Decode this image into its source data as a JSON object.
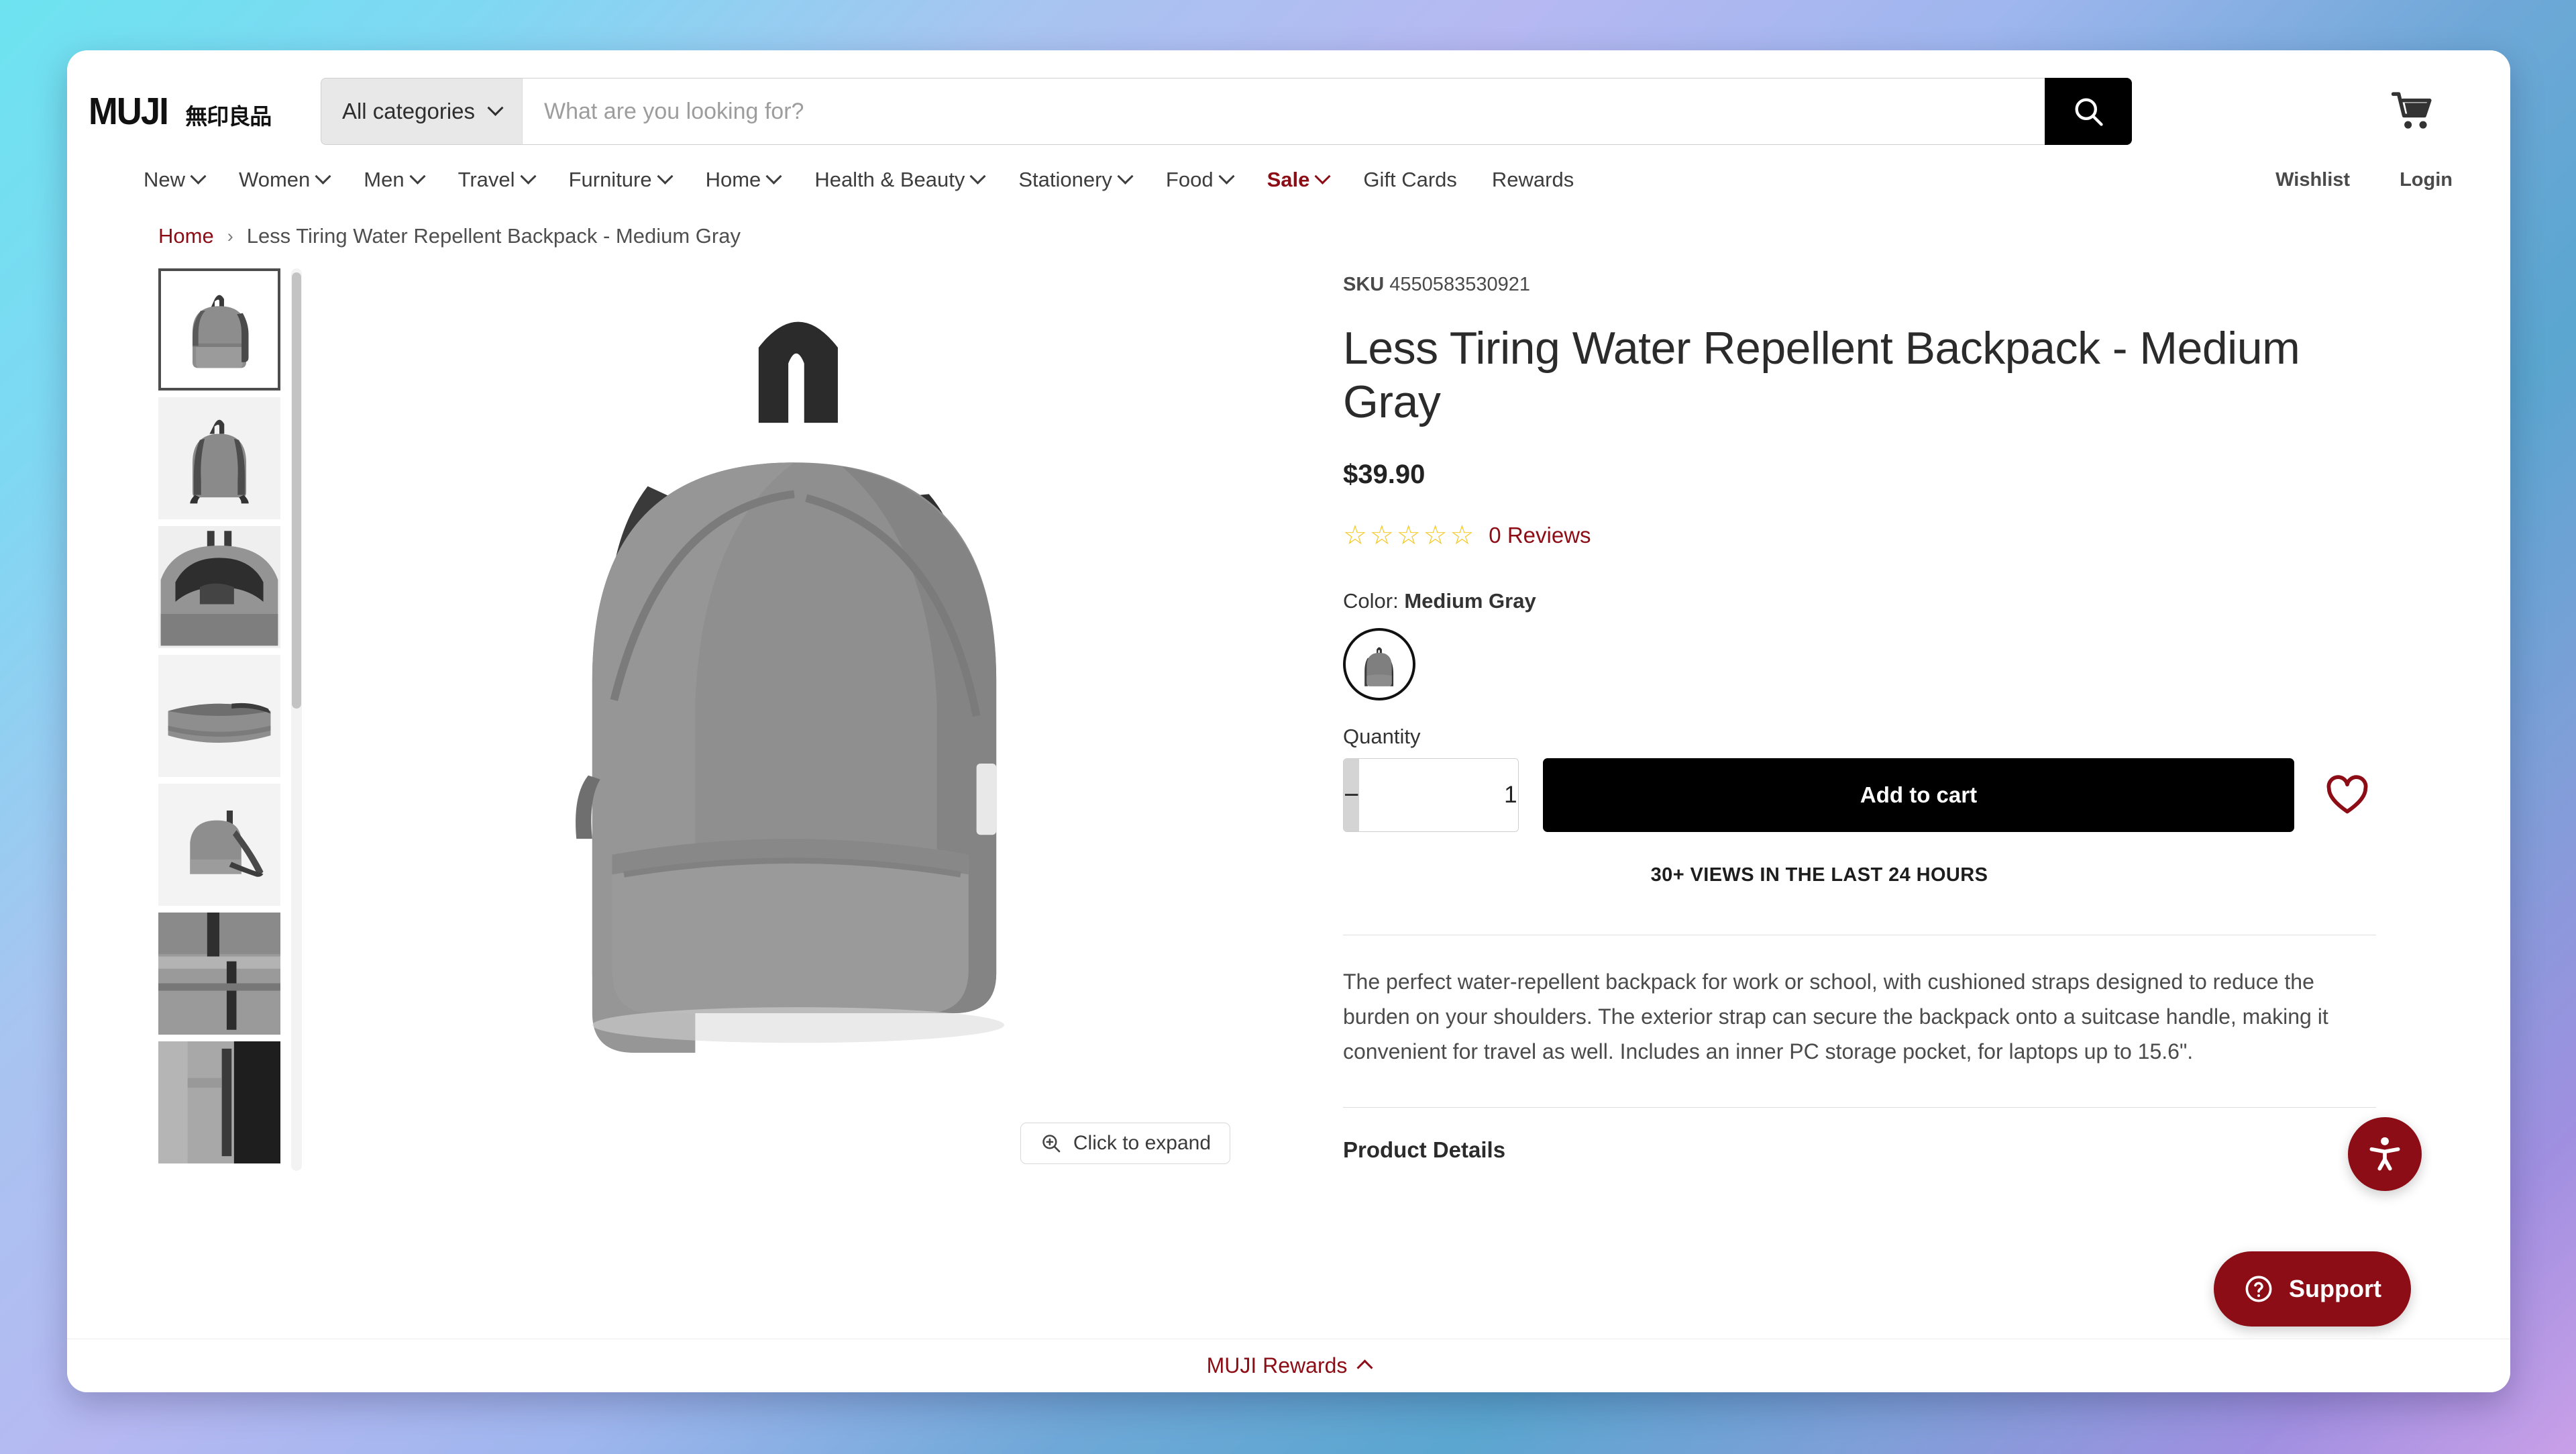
{
  "header": {
    "logo_text": "MUJI",
    "logo_jp": "無印良品",
    "category_select": "All categories",
    "search_placeholder": "What are you looking for?",
    "search_value": "",
    "search_icon": "search-icon",
    "cart_icon": "shopping-cart-icon"
  },
  "nav": {
    "items": [
      {
        "label": "New",
        "caret": true,
        "sale": false
      },
      {
        "label": "Women",
        "caret": true,
        "sale": false
      },
      {
        "label": "Men",
        "caret": true,
        "sale": false
      },
      {
        "label": "Travel",
        "caret": true,
        "sale": false
      },
      {
        "label": "Furniture",
        "caret": true,
        "sale": false
      },
      {
        "label": "Home",
        "caret": true,
        "sale": false
      },
      {
        "label": "Health & Beauty",
        "caret": true,
        "sale": false
      },
      {
        "label": "Stationery",
        "caret": true,
        "sale": false
      },
      {
        "label": "Food",
        "caret": true,
        "sale": false
      },
      {
        "label": "Sale",
        "caret": true,
        "sale": true
      },
      {
        "label": "Gift Cards",
        "caret": false,
        "sale": false
      },
      {
        "label": "Rewards",
        "caret": false,
        "sale": false
      }
    ],
    "right": [
      {
        "label": "Wishlist"
      },
      {
        "label": "Login"
      }
    ]
  },
  "breadcrumb": {
    "home": "Home",
    "separator": "›",
    "current": "Less Tiring Water Repellent Backpack - Medium Gray"
  },
  "gallery": {
    "expand_label": "Click to expand",
    "expand_icon": "zoom-in-icon",
    "thumbnails": [
      {
        "alt": "Backpack front view",
        "selected": true
      },
      {
        "alt": "Backpack back view",
        "selected": false
      },
      {
        "alt": "Backpack interior open",
        "selected": false
      },
      {
        "alt": "Backpack folded flat",
        "selected": false
      },
      {
        "alt": "Backpack side with strap",
        "selected": false
      },
      {
        "alt": "Backpack strap detail",
        "selected": false
      },
      {
        "alt": "Backpack pocket detail",
        "selected": false
      }
    ]
  },
  "product": {
    "sku_label": "SKU",
    "sku_value": "4550583530921",
    "title": "Less Tiring Water Repellent Backpack - Medium Gray",
    "price": "$39.90",
    "rating_stars": 0,
    "star_total": 5,
    "reviews_text": "0 Reviews",
    "color_label": "Color:",
    "color_value": "Medium Gray",
    "quantity_label": "Quantity",
    "quantity_value": "1",
    "qty_minus": "−",
    "qty_plus": "+",
    "add_to_cart": "Add to cart",
    "wishlist_icon": "heart-icon",
    "views_text": "30+ VIEWS IN THE LAST 24 HOURS",
    "description": "The perfect water-repellent backpack for work or school, with cushioned straps designed to reduce the burden on your shoulders. The exterior strap can secure the backpack onto a suitcase handle, making it convenient for travel as well. Includes an inner PC storage pocket, for laptops up to 15.6\".",
    "details_heading": "Product Details"
  },
  "widgets": {
    "accessibility_icon": "accessibility-icon",
    "support_label": "Support",
    "support_icon": "question-circle-icon",
    "rewards_label": "MUJI Rewards",
    "rewards_chevron": "chevron-up-icon"
  },
  "colors": {
    "brand_red": "#8c0d16",
    "star_yellow": "#f5c518",
    "black": "#000000",
    "text": "#2b2b2b"
  }
}
